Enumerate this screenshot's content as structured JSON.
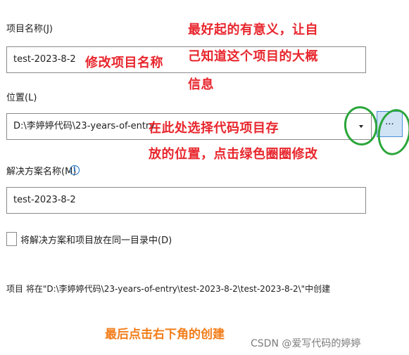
{
  "project_name": {
    "label": "项目名称(J)",
    "value": "test-2023-8-2"
  },
  "location": {
    "label": "位置(L)",
    "value": "D:\\李婷婷代码\\23-years-of-entry",
    "browse_label": "..."
  },
  "solution_name": {
    "label": "解决方案名称(M)",
    "value": "test-2023-8-2"
  },
  "same_dir_checkbox": {
    "label": "将解决方案和项目放在同一目录中(D)",
    "checked": false
  },
  "summary": "项目 将在\"D:\\李婷婷代码\\23-years-of-entry\\test-2023-8-2\\test-2023-8-2\\\"中创建",
  "annotations": {
    "name_tip_line1": "最好起的有意义，让自",
    "name_tip_line2": "己知道这个项目的大概",
    "name_tip_line3": "信息",
    "rename_tip": "修改项目名称",
    "location_tip_line1": "在此处选择代码项目存",
    "location_tip_line2": "放的位置，点击绿色圈圈修改",
    "create_tip": "最后点击右下角的创建",
    "circle_color": "#2aa63a",
    "annotation_red": "#e8262d",
    "annotation_orange": "#f27d1a"
  },
  "watermark": "CSDN @爱写代码的婷婷"
}
